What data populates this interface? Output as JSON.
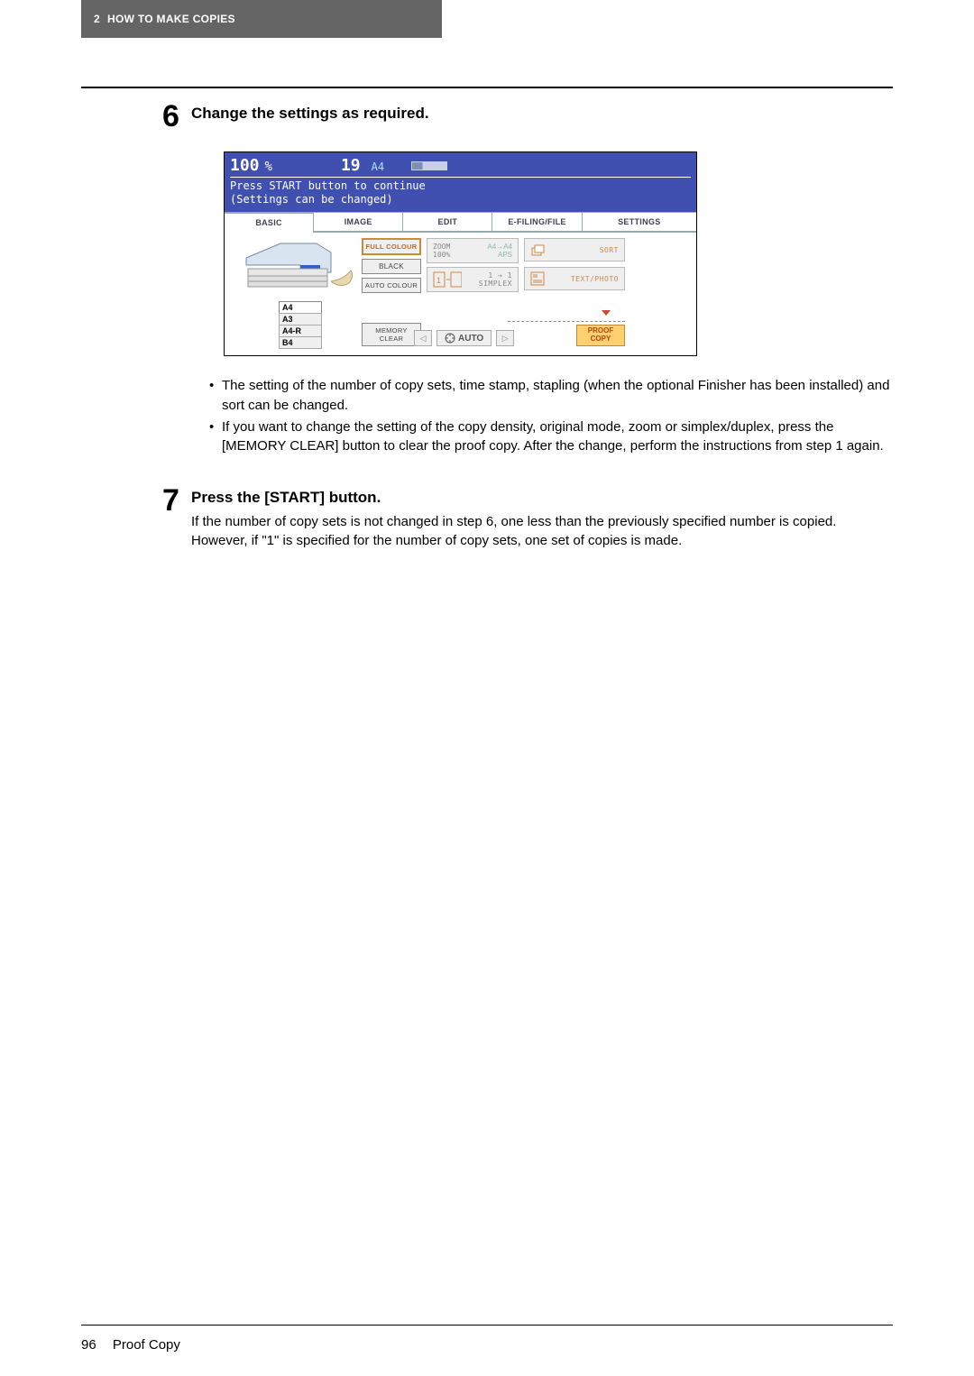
{
  "header": {
    "chapter_num": "2",
    "chapter_title": "HOW TO MAKE COPIES"
  },
  "steps": [
    {
      "num": "6",
      "title": "Change the settings as required."
    },
    {
      "num": "7",
      "title": "Press the [START] button.",
      "text": "If the number of copy sets is not changed in step 6, one less than the previously specified number is copied. However, if \"1\" is specified for the number of copy sets, one set of copies is made."
    }
  ],
  "screenshot": {
    "zoom": "100",
    "pct": "%",
    "count": "19",
    "paper": "A4",
    "msg1": "Press START button to continue",
    "msg2": "(Settings can be changed)",
    "tabs": [
      "BASIC",
      "IMAGE",
      "EDIT",
      "E-FILING/FILE",
      "SETTINGS"
    ],
    "trays": [
      "A4",
      "A3",
      "A4-R",
      "B4"
    ],
    "color_btns": [
      "FULL COLOUR",
      "BLACK",
      "AUTO COLOUR",
      "MEMORY CLEAR"
    ],
    "opts": {
      "zoom": {
        "t1": "ZOOM",
        "t2": "100%"
      },
      "aps": {
        "t1": "A4→A4",
        "t2": "APS"
      },
      "simplex": {
        "t1": "1 → 1",
        "t2": "SIMPLEX"
      },
      "sort": "SORT",
      "textphoto": "TEXT/PHOTO"
    },
    "auto": "AUTO",
    "proof": {
      "l1": "PROOF",
      "l2": "COPY"
    }
  },
  "bullets": [
    "The setting of the number of copy sets, time stamp, stapling (when the optional Finisher has been installed) and sort can be changed.",
    "If you want to change the setting of the copy density, original mode, zoom or simplex/duplex, press the [MEMORY CLEAR] button to clear the proof copy. After the change, perform the instructions from step 1 again."
  ],
  "footer": {
    "page": "96",
    "section": "Proof Copy"
  }
}
